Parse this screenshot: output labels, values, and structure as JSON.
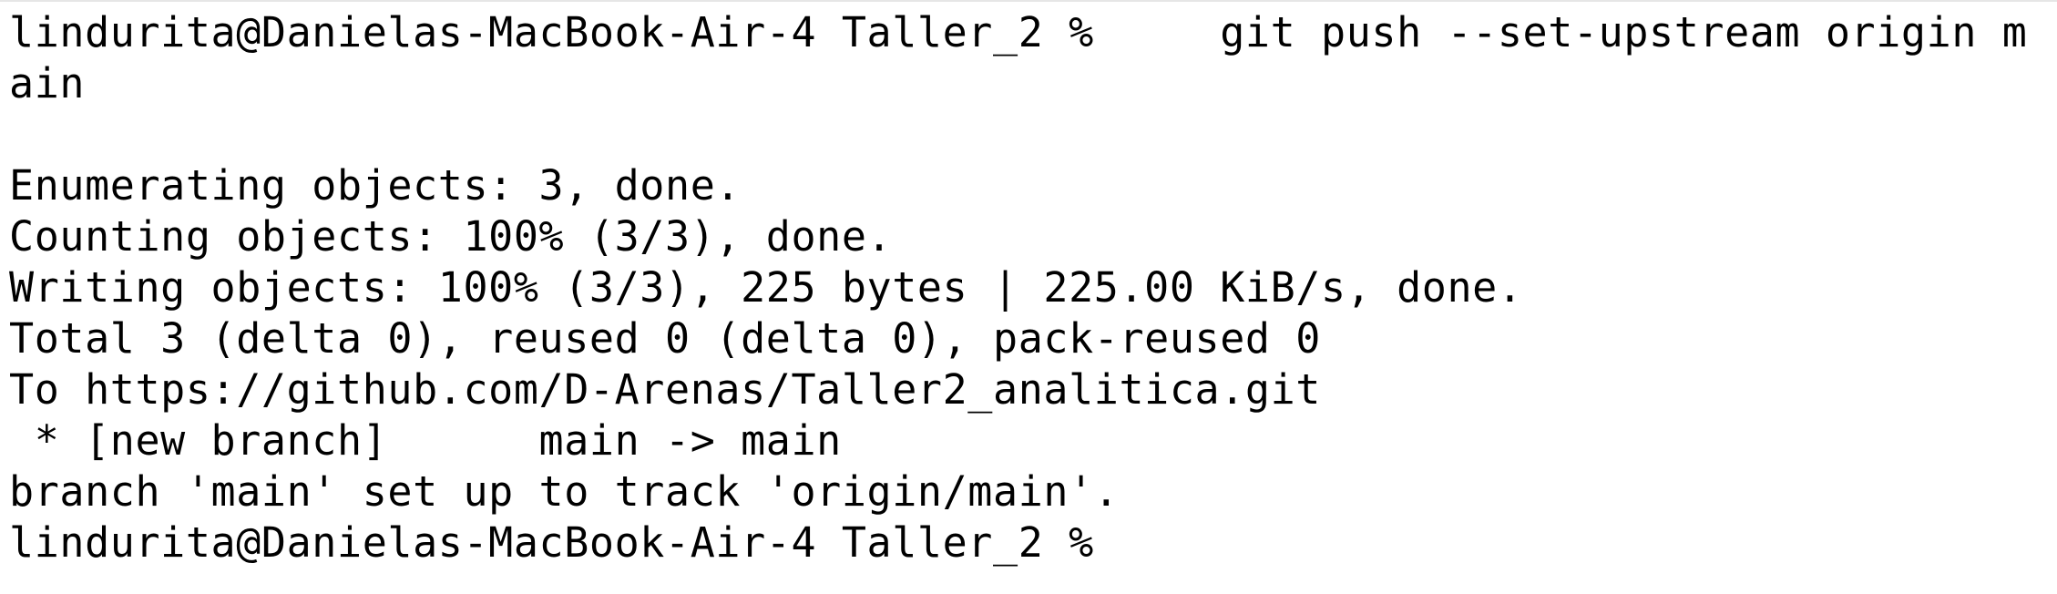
{
  "terminal": {
    "prompt": "lindurita@Danielas-MacBook-Air-4 Taller_2 %",
    "command_part1": "     git push --set-upstream origin m",
    "command_part2": "ain",
    "output": [
      "Enumerating objects: 3, done.",
      "Counting objects: 100% (3/3), done.",
      "Writing objects: 100% (3/3), 225 bytes | 225.00 KiB/s, done.",
      "Total 3 (delta 0), reused 0 (delta 0), pack-reused 0",
      "To https://github.com/D-Arenas/Taller2_analitica.git",
      " * [new branch]      main -> main",
      "branch 'main' set up to track 'origin/main'."
    ],
    "final_prompt": "lindurita@Danielas-MacBook-Air-4 Taller_2 %"
  }
}
